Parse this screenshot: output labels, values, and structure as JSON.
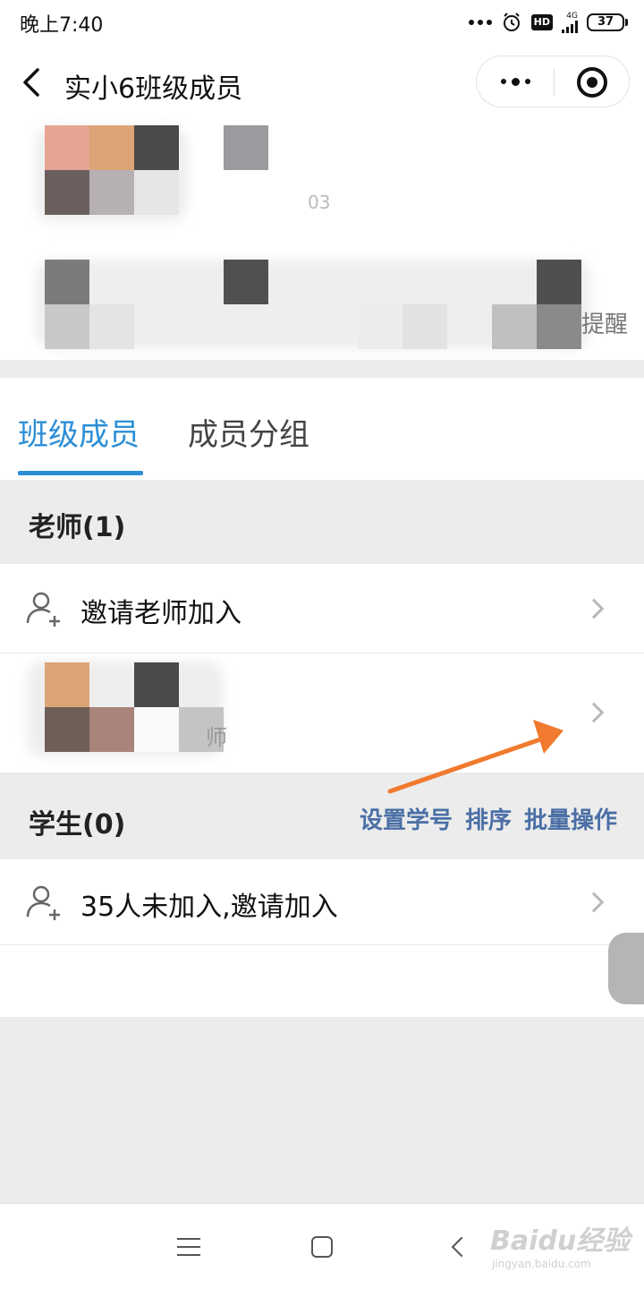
{
  "status_bar": {
    "time": "晚上7:40",
    "network_label": "4G",
    "battery": "37",
    "hd_label": "HD"
  },
  "navbar": {
    "title": "实小6班级成员"
  },
  "top_block": {
    "partial_text": "03",
    "remind_text": "提醒"
  },
  "tabs": [
    {
      "label": "班级成员",
      "active": true
    },
    {
      "label": "成员分组",
      "active": false
    }
  ],
  "teachers": {
    "title": "老师(1)",
    "invite_label": "邀请老师加入",
    "member_suffix": "师"
  },
  "students": {
    "title": "学生(0)",
    "actions": [
      "设置学号",
      "排序",
      "批量操作"
    ],
    "invite_label": "35人未加入,邀请加入"
  },
  "watermark": {
    "text": "Baidu经验",
    "sub": "jingyan.baidu.com"
  },
  "colors": {
    "accent": "#2b8ed6",
    "action_link": "#4a6fa5",
    "annotation_arrow": "#f07a2e"
  }
}
